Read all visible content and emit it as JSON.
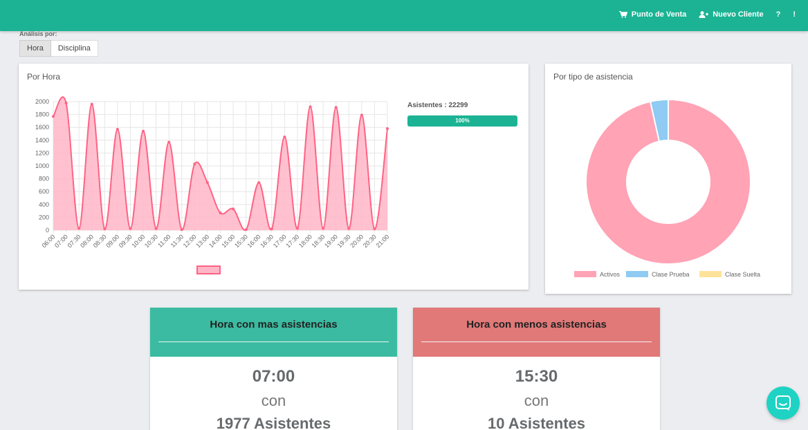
{
  "topbar": {
    "pos_label": "Punto de Venta",
    "new_client_label": "Nuevo Cliente",
    "help_label": "?",
    "more_label": "!",
    "color": "#1bb394"
  },
  "analysis": {
    "label": "Análisis por:",
    "options": [
      "Hora",
      "Disciplina"
    ],
    "selected": "Hora"
  },
  "hour_panel": {
    "title": "Por Hora",
    "attendees_label": "Asistentes : 22299",
    "progress_label": "100%",
    "progress": 1.0
  },
  "chart_data": [
    {
      "type": "area",
      "x": [
        "06:00",
        "07:00",
        "07:30",
        "08:00",
        "08:30",
        "09:00",
        "09:30",
        "10:00",
        "10:30",
        "11:00",
        "11:30",
        "12:00",
        "13:00",
        "14:00",
        "15:00",
        "15:30",
        "16:00",
        "16:30",
        "17:00",
        "17:30",
        "18:00",
        "18:30",
        "19:00",
        "19:30",
        "20:00",
        "20:30",
        "21:00"
      ],
      "series": [
        {
          "values": [
            1770,
            1977,
            30,
            1960,
            20,
            1570,
            25,
            1540,
            25,
            1370,
            10,
            1030,
            740,
            270,
            330,
            10,
            740,
            20,
            1450,
            30,
            1920,
            30,
            1910,
            25,
            1790,
            20,
            1580
          ],
          "color": "#ff6384",
          "fill": "#ffb6c7"
        }
      ],
      "y_ticks": [
        "0",
        "200",
        "400",
        "600",
        "800",
        "1000",
        "1200",
        "1400",
        "1600",
        "1800",
        "2000"
      ],
      "ylim": [
        0,
        2000
      ],
      "grid": true,
      "legend": "bottom"
    },
    {
      "type": "pie",
      "title": "Por tipo de asistencia",
      "labels": [
        "Activos",
        "Clase Prueba",
        "Clase Suelta"
      ],
      "values": [
        96.5,
        3.5,
        0
      ],
      "colors": [
        "#ffa3b5",
        "#8fcbf2",
        "#ffe29a"
      ],
      "legend": "bottom"
    }
  ],
  "cards": {
    "max": {
      "title": "Hora con mas asistencias",
      "hour": "07:00",
      "con": "con",
      "count": "1977 Asistentes",
      "color": "#3bbba1"
    },
    "min": {
      "title": "Hora con menos asistencias",
      "hour": "15:30",
      "con": "con",
      "count": "10 Asistentes",
      "color": "#e07978"
    }
  },
  "chat": {
    "icon": "chat-icon",
    "color": "#1ed3c3"
  }
}
